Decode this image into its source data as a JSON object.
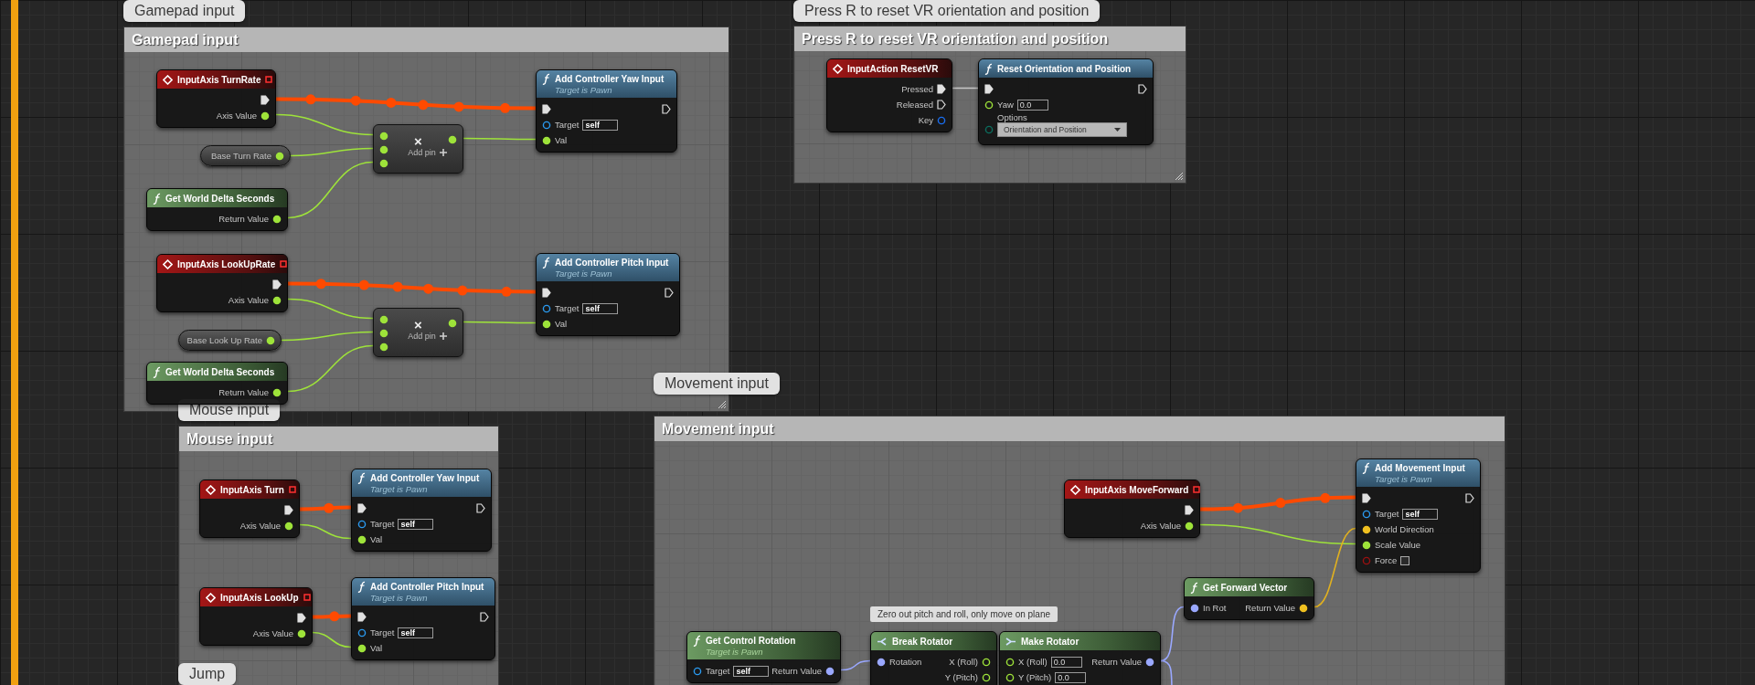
{
  "comments": [
    {
      "title": "Gamepad input",
      "bubble": "Gamepad input",
      "nodes": [
        {
          "kind": "event",
          "title": "InputAxis TurnRate",
          "delegate_pin": true,
          "outputs": [
            {
              "kind": "exec",
              "connected": true
            },
            {
              "kind": "float",
              "label": "Axis Value",
              "connected": true
            }
          ]
        },
        {
          "kind": "variable",
          "title": "Base Turn Rate",
          "outputs": [
            {
              "kind": "float",
              "connected": true
            }
          ]
        },
        {
          "kind": "pure",
          "title": "Get World Delta Seconds",
          "outputs": [
            {
              "kind": "float",
              "label": "Return Value",
              "connected": true
            }
          ]
        },
        {
          "kind": "math",
          "symbol": "×",
          "add_pin": "Add pin",
          "inputs": [
            {
              "kind": "float",
              "connected": true
            },
            {
              "kind": "float",
              "connected": true
            },
            {
              "kind": "float",
              "connected": true
            }
          ],
          "outputs": [
            {
              "kind": "float",
              "connected": true
            }
          ]
        },
        {
          "kind": "call",
          "title": "Add Controller Yaw Input",
          "subtitle": "Target is Pawn",
          "inputs": [
            {
              "kind": "exec",
              "connected": true
            },
            {
              "kind": "object",
              "label": "Target",
              "default": "self",
              "connected": false
            },
            {
              "kind": "float",
              "label": "Val",
              "connected": true
            }
          ],
          "outputs": [
            {
              "kind": "exec",
              "connected": false
            }
          ]
        },
        {
          "kind": "event",
          "title": "InputAxis LookUpRate",
          "delegate_pin": true,
          "outputs": [
            {
              "kind": "exec",
              "connected": true
            },
            {
              "kind": "float",
              "label": "Axis Value",
              "connected": true
            }
          ]
        },
        {
          "kind": "variable",
          "title": "Base Look Up Rate",
          "outputs": [
            {
              "kind": "float",
              "connected": true
            }
          ]
        },
        {
          "kind": "pure",
          "title": "Get World Delta Seconds",
          "outputs": [
            {
              "kind": "float",
              "label": "Return Value",
              "connected": true
            }
          ]
        },
        {
          "kind": "math",
          "symbol": "×",
          "add_pin": "Add pin",
          "inputs": [
            {
              "kind": "float",
              "connected": true
            },
            {
              "kind": "float",
              "connected": true
            },
            {
              "kind": "float",
              "connected": true
            }
          ],
          "outputs": [
            {
              "kind": "float",
              "connected": true
            }
          ]
        },
        {
          "kind": "call",
          "title": "Add Controller Pitch Input",
          "subtitle": "Target is Pawn",
          "inputs": [
            {
              "kind": "exec",
              "connected": true
            },
            {
              "kind": "object",
              "label": "Target",
              "default": "self",
              "connected": false
            },
            {
              "kind": "float",
              "label": "Val",
              "connected": true
            }
          ],
          "outputs": [
            {
              "kind": "exec",
              "connected": false
            }
          ]
        }
      ]
    },
    {
      "title": "Press R to reset VR orientation and position",
      "bubble": "Press R to reset VR orientation and position",
      "nodes": [
        {
          "kind": "event",
          "title": "InputAction ResetVR",
          "delegate_pin": false,
          "outputs": [
            {
              "kind": "exec",
              "label": "Pressed",
              "connected": true
            },
            {
              "kind": "exec",
              "label": "Released",
              "connected": false
            },
            {
              "kind": "struct",
              "label": "Key",
              "connected": false
            }
          ]
        },
        {
          "kind": "call",
          "title": "Reset Orientation and Position",
          "inputs": [
            {
              "kind": "exec",
              "connected": true
            },
            {
              "kind": "float",
              "label": "Yaw",
              "default": "0.0",
              "connected": false
            },
            {
              "kind": "enum",
              "label": "Options",
              "default": "Orientation and Position",
              "connected": false
            }
          ],
          "outputs": [
            {
              "kind": "exec",
              "connected": false
            }
          ]
        }
      ]
    },
    {
      "title": "Mouse input",
      "bubble": "Mouse input",
      "nodes": [
        {
          "kind": "event",
          "title": "InputAxis Turn",
          "delegate_pin": true,
          "outputs": [
            {
              "kind": "exec",
              "connected": true
            },
            {
              "kind": "float",
              "label": "Axis Value",
              "connected": true
            }
          ]
        },
        {
          "kind": "call",
          "title": "Add Controller Yaw Input",
          "subtitle": "Target is Pawn",
          "inputs": [
            {
              "kind": "exec",
              "connected": true
            },
            {
              "kind": "object",
              "label": "Target",
              "default": "self",
              "connected": false
            },
            {
              "kind": "float",
              "label": "Val",
              "connected": true
            }
          ],
          "outputs": [
            {
              "kind": "exec",
              "connected": false
            }
          ]
        },
        {
          "kind": "event",
          "title": "InputAxis LookUp",
          "delegate_pin": true,
          "outputs": [
            {
              "kind": "exec",
              "connected": true
            },
            {
              "kind": "float",
              "label": "Axis Value",
              "connected": true
            }
          ]
        },
        {
          "kind": "call",
          "title": "Add Controller Pitch Input",
          "subtitle": "Target is Pawn",
          "inputs": [
            {
              "kind": "exec",
              "connected": true
            },
            {
              "kind": "object",
              "label": "Target",
              "default": "self",
              "connected": false
            },
            {
              "kind": "float",
              "label": "Val",
              "connected": true
            }
          ],
          "outputs": [
            {
              "kind": "exec",
              "connected": false
            }
          ]
        }
      ]
    },
    {
      "bubble": "Jump"
    },
    {
      "title": "Movement input",
      "bubble": "Movement input",
      "nodes": [
        {
          "kind": "event",
          "title": "InputAxis MoveForward",
          "delegate_pin": true,
          "outputs": [
            {
              "kind": "exec",
              "connected": true
            },
            {
              "kind": "float",
              "label": "Axis Value",
              "connected": true
            }
          ]
        },
        {
          "kind": "call",
          "title": "Add Movement Input",
          "subtitle": "Target is Pawn",
          "inputs": [
            {
              "kind": "exec",
              "connected": true
            },
            {
              "kind": "object",
              "label": "Target",
              "default": "self",
              "connected": false
            },
            {
              "kind": "vector",
              "label": "World Direction",
              "connected": true
            },
            {
              "kind": "float",
              "label": "Scale Value",
              "connected": true
            },
            {
              "kind": "bool",
              "label": "Force",
              "checked": false,
              "connected": false
            }
          ],
          "outputs": [
            {
              "kind": "exec",
              "connected": false
            }
          ]
        },
        {
          "kind": "pure",
          "title": "Get Forward Vector",
          "inputs": [
            {
              "kind": "rotator",
              "label": "In Rot",
              "connected": true
            }
          ],
          "outputs": [
            {
              "kind": "vector",
              "label": "Return Value",
              "connected": true
            }
          ]
        },
        {
          "kind": "pure",
          "title": "Get Control Rotation",
          "subtitle": "Target is Pawn",
          "inputs": [
            {
              "kind": "object",
              "label": "Target",
              "default": "self",
              "connected": false
            }
          ],
          "outputs": [
            {
              "kind": "rotator",
              "label": "Return Value",
              "connected": true
            }
          ]
        },
        {
          "kind": "break",
          "title": "Break Rotator",
          "comment": "Zero out pitch and roll, only move on plane",
          "inputs": [
            {
              "kind": "rotator",
              "label": "Rotation",
              "connected": true
            }
          ],
          "outputs": [
            {
              "kind": "float",
              "label": "X (Roll)",
              "connected": false
            },
            {
              "kind": "float",
              "label": "Y (Pitch)",
              "connected": false
            }
          ]
        },
        {
          "kind": "make",
          "title": "Make Rotator",
          "inputs": [
            {
              "kind": "float",
              "label": "X (Roll)",
              "default": "0.0",
              "connected": false
            },
            {
              "kind": "float",
              "label": "Y (Pitch)",
              "default": "0.0",
              "connected": false
            }
          ],
          "outputs": [
            {
              "kind": "rotator",
              "label": "Return Value",
              "connected": true
            }
          ]
        }
      ]
    }
  ]
}
